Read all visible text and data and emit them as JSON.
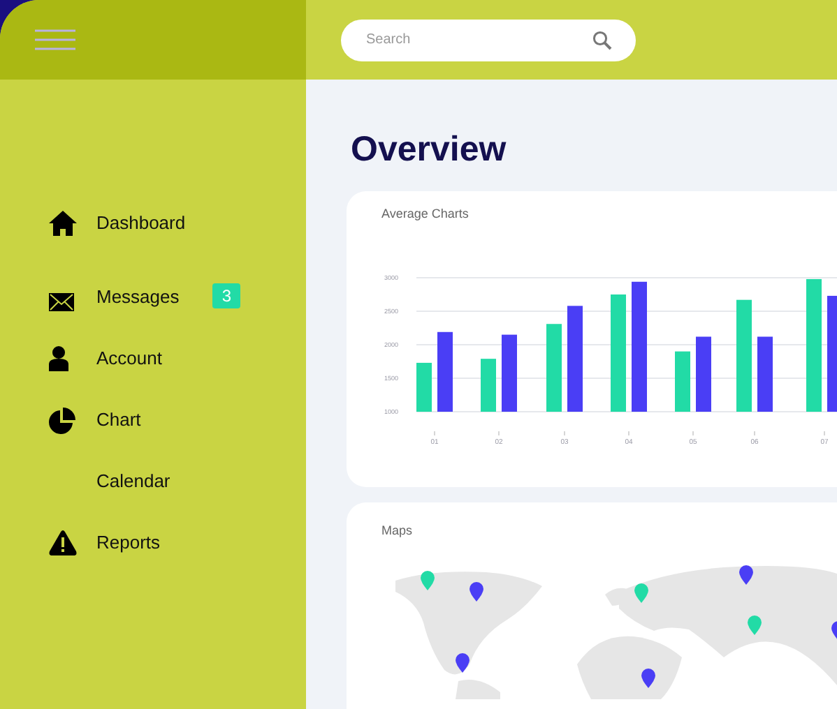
{
  "search": {
    "placeholder": "Search"
  },
  "sidebar": {
    "items": [
      {
        "label": "Dashboard"
      },
      {
        "label": "Messages",
        "badge": "3"
      },
      {
        "label": "Account"
      },
      {
        "label": "Chart"
      },
      {
        "label": "Calendar"
      },
      {
        "label": "Reports"
      }
    ]
  },
  "title": "Overview",
  "average_charts": {
    "title": "Average Charts",
    "chart_data": {
      "type": "bar",
      "categories": [
        "01",
        "02",
        "03",
        "04",
        "05",
        "06",
        "07"
      ],
      "series": [
        {
          "color": "#22dba6",
          "values": [
            1730,
            1790,
            2310,
            2750,
            1900,
            2670,
            2980
          ]
        },
        {
          "color": "#4a3ef5",
          "values": [
            2190,
            2150,
            2580,
            2940,
            2120,
            2120,
            2730
          ]
        }
      ],
      "ylim": [
        1000,
        3000
      ],
      "grid": true,
      "yticks": [
        1000,
        1500,
        2000,
        2500,
        3000
      ]
    }
  },
  "maps": {
    "title": "Maps",
    "pins": [
      {
        "color": "#22dba6"
      },
      {
        "color": "#4a3ef5"
      },
      {
        "color": "#4a3ef5"
      },
      {
        "color": "#22dba6"
      },
      {
        "color": "#4a3ef5"
      },
      {
        "color": "#22dba6"
      },
      {
        "color": "#4a3ef5"
      },
      {
        "color": "#4a3ef5"
      }
    ]
  }
}
